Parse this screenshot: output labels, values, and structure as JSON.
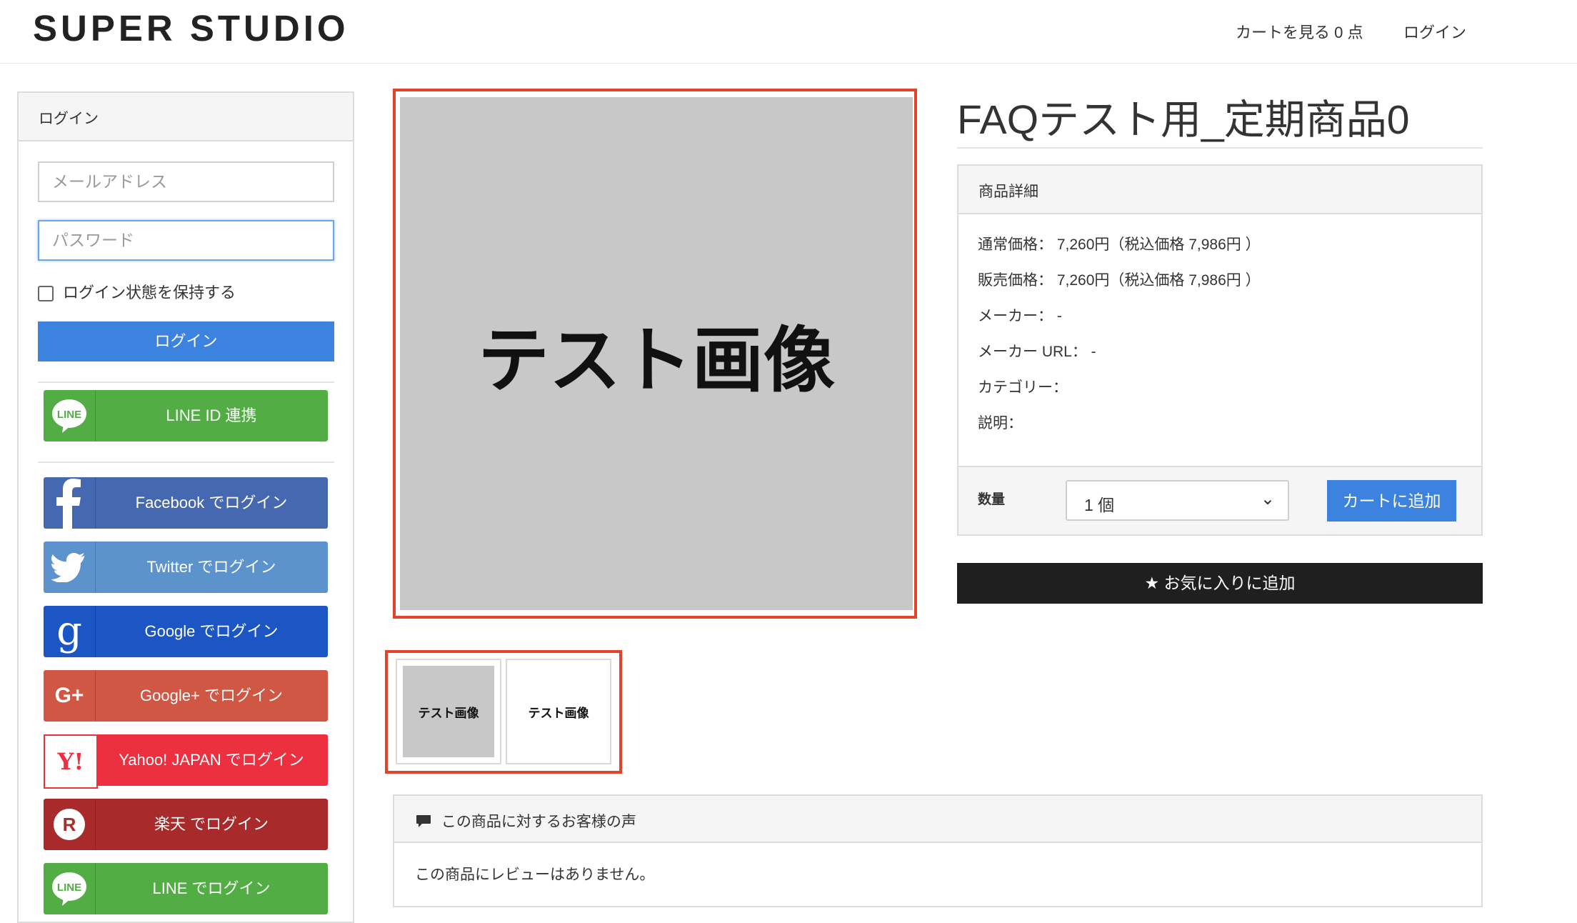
{
  "header": {
    "logo": "SUPER STUDIO",
    "cart_label": "カートを見る",
    "cart_count": "0 点",
    "login_link": "ログイン"
  },
  "login_panel": {
    "title": "ログイン",
    "email_placeholder": "メールアドレス",
    "password_placeholder": "パスワード",
    "remember_label": "ログイン状態を保持する",
    "login_button": "ログイン",
    "line_link_button": "LINE ID 連携",
    "social_buttons": [
      {
        "label": "Facebook でログイン",
        "icon": "facebook-icon",
        "color": "#4668b0"
      },
      {
        "label": "Twitter でログイン",
        "icon": "twitter-icon",
        "color": "#5d93cc"
      },
      {
        "label": "Google でログイン",
        "icon": "google-icon",
        "color": "#1c56c4"
      },
      {
        "label": "Google+ でログイン",
        "icon": "google-plus-icon",
        "color": "#cf5744"
      },
      {
        "label": "Yahoo! JAPAN でログイン",
        "icon": "yahoo-icon",
        "color": "#ec3040"
      },
      {
        "label": "楽天 でログイン",
        "icon": "rakuten-icon",
        "color": "#a82a2a"
      },
      {
        "label": "LINE でログイン",
        "icon": "line-icon",
        "color": "#52ad44"
      }
    ],
    "line_color": "#52ad44",
    "login_color": "#3c83e0"
  },
  "product": {
    "main_image_text": "テスト画像",
    "thumbnails": [
      "テスト画像",
      "テスト画像"
    ],
    "title": "FAQテスト用_定期商品0",
    "details_title": "商品詳細",
    "details": [
      "通常価格： 7,260円（税込価格 7,986円 ）",
      "販売価格： 7,260円（税込価格 7,986円 ）",
      "メーカー： -",
      "メーカー URL： -",
      "カテゴリー：",
      "説明："
    ],
    "quantity_label": "数量",
    "quantity_value": "1 個",
    "add_to_cart": "カートに追加",
    "favorite_button": "★ お気に入りに追加"
  },
  "reviews": {
    "title": "この商品に対するお客様の声",
    "empty_text": "この商品にレビューはありません。"
  },
  "colors": {
    "highlight": "#e0452c",
    "primary": "#3c83e0",
    "dark": "#1f1f1f"
  }
}
